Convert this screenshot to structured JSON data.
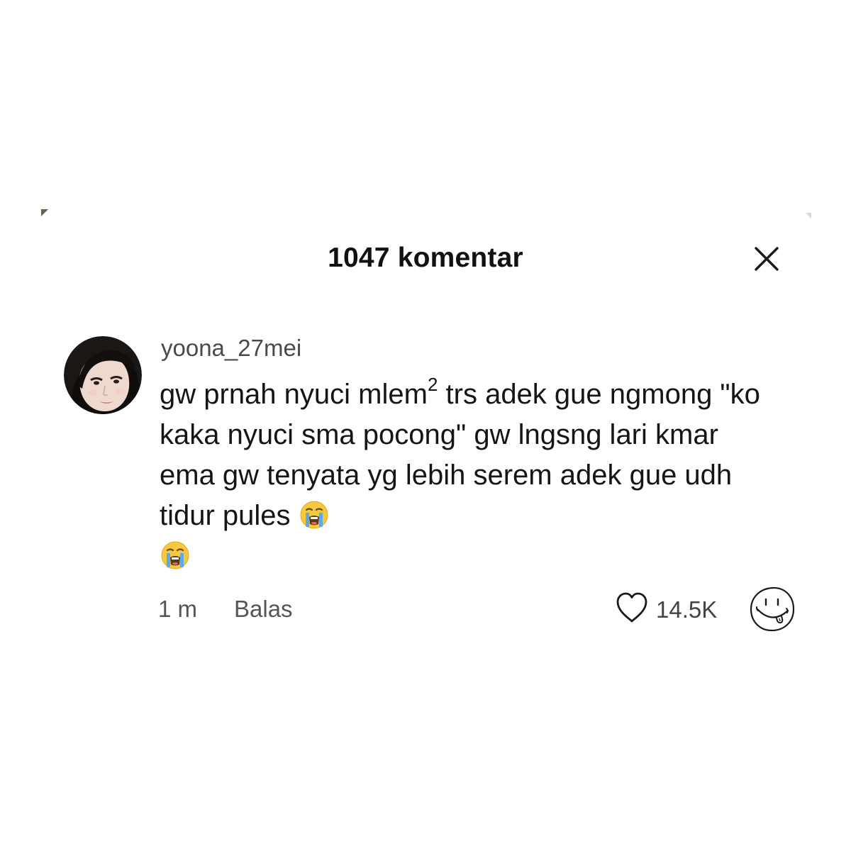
{
  "sheet": {
    "title": "1047 komentar"
  },
  "comment": {
    "username": "yoona_27mei",
    "text_before_sup": "gw prnah nyuci mlem",
    "sup": "2",
    "text_after_sup": " trs adek gue ngmong \"ko kaka nyuci sma pocong\" gw lngsng lari kmar ema gw tenyata yg lebih serem adek gue udh tidur pules",
    "emojis": [
      "loudly-crying-face-emoji",
      "loudly-crying-face-emoji"
    ],
    "time": "1 m",
    "reply_label": "Balas",
    "like_count": "14.5K"
  },
  "icons": {
    "close": "close-icon",
    "like": "heart-outline-icon",
    "sticker": "smiley-doodle-icon",
    "avatar": "user-avatar"
  },
  "colors": {
    "background": "#ffffff",
    "text_primary": "#151515",
    "text_secondary": "#555555"
  }
}
